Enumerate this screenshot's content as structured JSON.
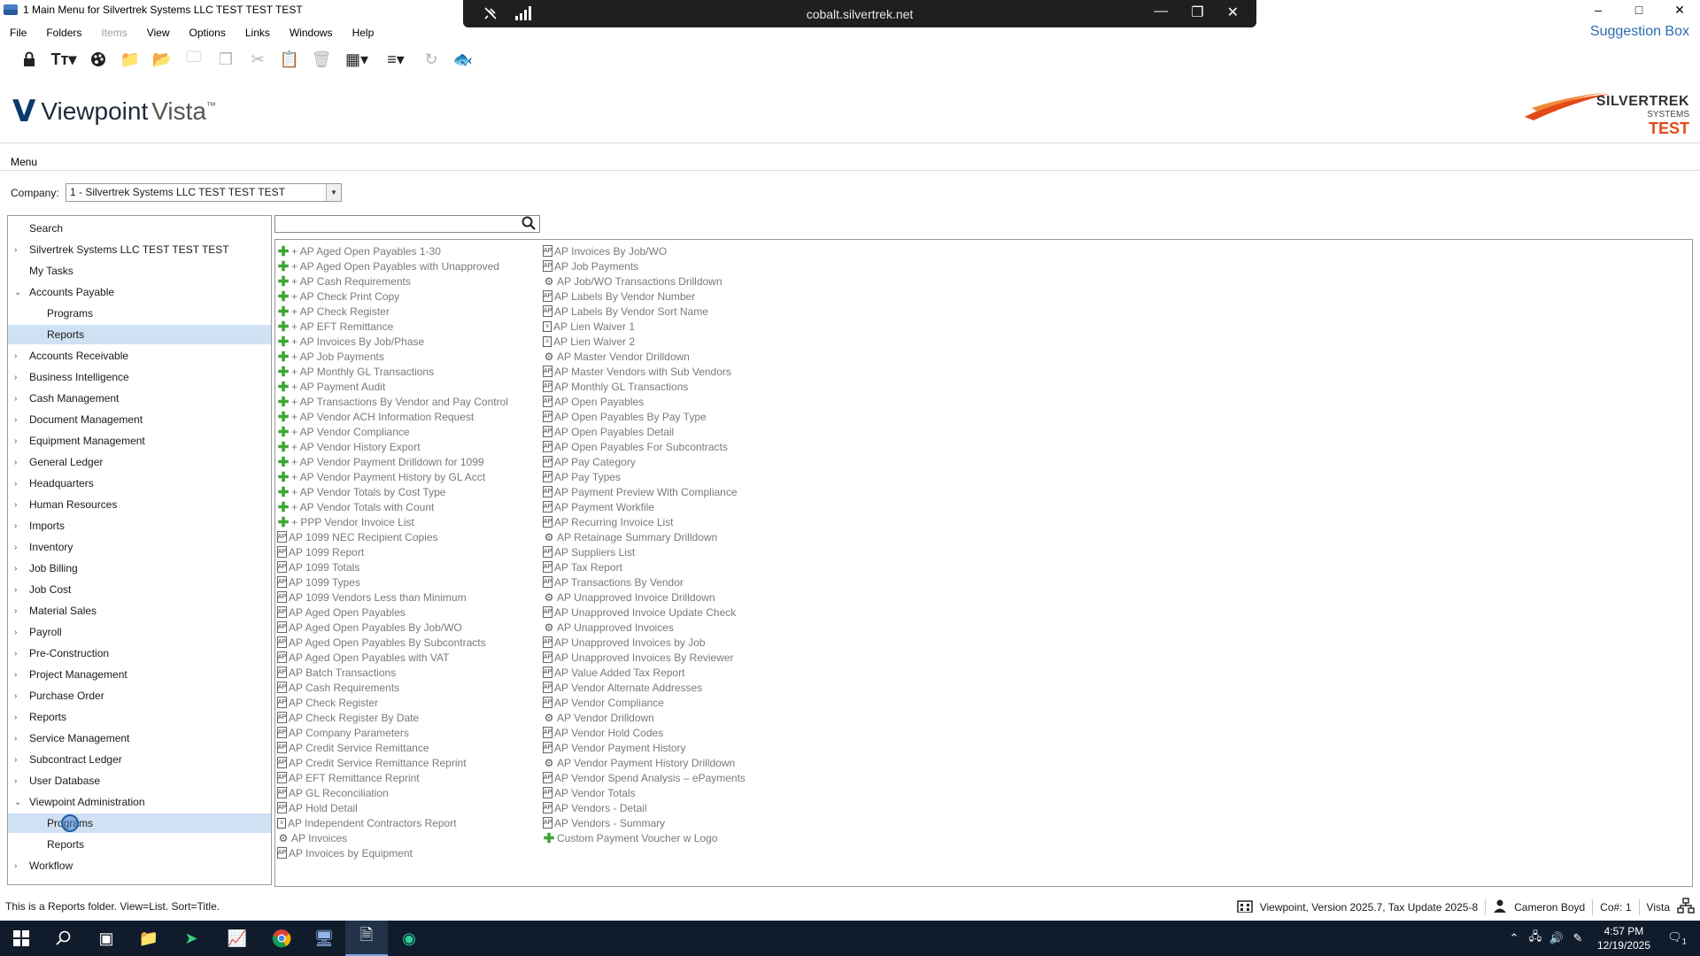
{
  "window": {
    "title": "1 Main Menu for Silvertrek Systems LLC TEST TEST TEST",
    "minimize": "–",
    "maximize": "□",
    "close": "✕"
  },
  "remote": {
    "host": "cobalt.silvertrek.net",
    "minimize": "—",
    "restore": "❐",
    "close": "✕"
  },
  "menubar": {
    "items": [
      "File",
      "Folders",
      "Items",
      "View",
      "Options",
      "Links",
      "Windows",
      "Help"
    ],
    "disabled_index": 2,
    "suggestion": "Suggestion Box"
  },
  "logos": {
    "viewpoint": "Viewpoint",
    "vista": "Vista",
    "tm": "™",
    "silvertrek_1": "SILVERTREK",
    "silvertrek_2": "SYSTEMS",
    "silvertrek_3": "TEST"
  },
  "tabs": {
    "menu": "Menu"
  },
  "company": {
    "label": "Company:",
    "value": "1 - Silvertrek Systems LLC TEST TEST TEST"
  },
  "nav": [
    {
      "label": "Search",
      "level": 0,
      "chev": ""
    },
    {
      "label": "Silvertrek Systems LLC TEST TEST TEST",
      "level": 0,
      "chev": "›"
    },
    {
      "label": "My Tasks",
      "level": 0,
      "chev": ""
    },
    {
      "label": "Accounts Payable",
      "level": 0,
      "chev": "⌄"
    },
    {
      "label": "Programs",
      "level": 1,
      "chev": ""
    },
    {
      "label": "Reports",
      "level": 1,
      "chev": ""
    },
    {
      "label": "Accounts Receivable",
      "level": 0,
      "chev": "›"
    },
    {
      "label": "Business Intelligence",
      "level": 0,
      "chev": "›"
    },
    {
      "label": "Cash Management",
      "level": 0,
      "chev": "›"
    },
    {
      "label": "Document Management",
      "level": 0,
      "chev": "›"
    },
    {
      "label": "Equipment Management",
      "level": 0,
      "chev": "›"
    },
    {
      "label": "General Ledger",
      "level": 0,
      "chev": "›"
    },
    {
      "label": "Headquarters",
      "level": 0,
      "chev": "›"
    },
    {
      "label": "Human Resources",
      "level": 0,
      "chev": "›"
    },
    {
      "label": "Imports",
      "level": 0,
      "chev": "›"
    },
    {
      "label": "Inventory",
      "level": 0,
      "chev": "›"
    },
    {
      "label": "Job Billing",
      "level": 0,
      "chev": "›"
    },
    {
      "label": "Job Cost",
      "level": 0,
      "chev": "›"
    },
    {
      "label": "Material Sales",
      "level": 0,
      "chev": "›"
    },
    {
      "label": "Payroll",
      "level": 0,
      "chev": "›"
    },
    {
      "label": "Pre-Construction",
      "level": 0,
      "chev": "›"
    },
    {
      "label": "Project Management",
      "level": 0,
      "chev": "›"
    },
    {
      "label": "Purchase Order",
      "level": 0,
      "chev": "›"
    },
    {
      "label": "Reports",
      "level": 0,
      "chev": "›"
    },
    {
      "label": "Service Management",
      "level": 0,
      "chev": "›"
    },
    {
      "label": "Subcontract Ledger",
      "level": 0,
      "chev": "›"
    },
    {
      "label": "User Database",
      "level": 0,
      "chev": "›"
    },
    {
      "label": "Viewpoint Administration",
      "level": 0,
      "chev": "⌄"
    },
    {
      "label": "Programs",
      "level": 1,
      "chev": ""
    },
    {
      "label": "Reports",
      "level": 1,
      "chev": ""
    },
    {
      "label": "Workflow",
      "level": 0,
      "chev": "›"
    }
  ],
  "nav_selected": [
    5,
    28
  ],
  "search": {
    "placeholder": ""
  },
  "reports_col1": [
    {
      "t": "+ AP Aged Open Payables 1-30",
      "i": "plus"
    },
    {
      "t": "+ AP Aged Open Payables with Unapproved",
      "i": "plus"
    },
    {
      "t": "+ AP Cash Requirements",
      "i": "plus"
    },
    {
      "t": "+ AP Check Print Copy",
      "i": "plus"
    },
    {
      "t": "+ AP Check Register",
      "i": "plus"
    },
    {
      "t": "+ AP EFT Remittance",
      "i": "plus"
    },
    {
      "t": "+ AP Invoices By Job/Phase",
      "i": "plus"
    },
    {
      "t": "+ AP Job Payments",
      "i": "plus"
    },
    {
      "t": "+ AP Monthly GL Transactions",
      "i": "plus"
    },
    {
      "t": "+ AP Payment Audit",
      "i": "plus"
    },
    {
      "t": "+ AP Transactions By Vendor and Pay Control",
      "i": "plus"
    },
    {
      "t": "+ AP Vendor ACH Information Request",
      "i": "plus"
    },
    {
      "t": "+ AP Vendor Compliance",
      "i": "plus"
    },
    {
      "t": "+ AP Vendor History Export",
      "i": "plus"
    },
    {
      "t": "+ AP Vendor Payment Drilldown for 1099",
      "i": "plus"
    },
    {
      "t": "+ AP Vendor Payment History by GL Acct",
      "i": "plus"
    },
    {
      "t": "+ AP Vendor Totals by Cost Type",
      "i": "plus"
    },
    {
      "t": "+ AP Vendor Totals with Count",
      "i": "plus"
    },
    {
      "t": "+ PPP Vendor Invoice List",
      "i": "plus"
    },
    {
      "t": "AP 1099 NEC Recipient Copies",
      "i": "rep"
    },
    {
      "t": "AP 1099 Report",
      "i": "rep"
    },
    {
      "t": "AP 1099 Totals",
      "i": "rep"
    },
    {
      "t": "AP 1099 Types",
      "i": "rep"
    },
    {
      "t": "AP 1099 Vendors Less than Minimum",
      "i": "rep"
    },
    {
      "t": "AP Aged Open Payables",
      "i": "rep"
    },
    {
      "t": "AP Aged Open Payables By Job/WO",
      "i": "rep"
    },
    {
      "t": "AP Aged Open Payables By Subcontracts",
      "i": "rep"
    },
    {
      "t": "AP Aged Open Payables with VAT",
      "i": "rep"
    },
    {
      "t": "AP Batch Transactions",
      "i": "rep"
    },
    {
      "t": "AP Cash Requirements",
      "i": "rep"
    },
    {
      "t": "AP Check Register",
      "i": "rep"
    },
    {
      "t": "AP Check Register By Date",
      "i": "rep"
    },
    {
      "t": "AP Company Parameters",
      "i": "rep"
    },
    {
      "t": "AP Credit Service Remittance",
      "i": "rep"
    },
    {
      "t": "AP Credit Service Remittance Reprint",
      "i": "rep"
    },
    {
      "t": "AP EFT Remittance Reprint",
      "i": "rep"
    },
    {
      "t": "AP GL Reconciliation",
      "i": "rep"
    },
    {
      "t": "AP Hold Detail",
      "i": "rep"
    },
    {
      "t": "AP Independent Contractors Report",
      "i": "doc"
    },
    {
      "t": "AP Invoices",
      "i": "gear"
    },
    {
      "t": "AP Invoices by Equipment",
      "i": "rep"
    }
  ],
  "reports_col2": [
    {
      "t": "AP Invoices By Job/WO",
      "i": "rep"
    },
    {
      "t": "AP Job Payments",
      "i": "rep"
    },
    {
      "t": "AP Job/WO Transactions Drilldown",
      "i": "gear"
    },
    {
      "t": "AP Labels By Vendor Number",
      "i": "rep"
    },
    {
      "t": "AP Labels By Vendor Sort Name",
      "i": "rep"
    },
    {
      "t": "AP Lien Waiver 1",
      "i": "doc"
    },
    {
      "t": "AP Lien Waiver 2",
      "i": "doc"
    },
    {
      "t": "AP Master Vendor Drilldown",
      "i": "gear"
    },
    {
      "t": "AP Master Vendors with Sub Vendors",
      "i": "rep"
    },
    {
      "t": "AP Monthly GL Transactions",
      "i": "rep"
    },
    {
      "t": "AP Open Payables",
      "i": "rep"
    },
    {
      "t": "AP Open Payables By Pay Type",
      "i": "rep"
    },
    {
      "t": "AP Open Payables Detail",
      "i": "rep"
    },
    {
      "t": "AP Open Payables For Subcontracts",
      "i": "rep"
    },
    {
      "t": "AP Pay Category",
      "i": "rep"
    },
    {
      "t": "AP Pay Types",
      "i": "rep"
    },
    {
      "t": "AP Payment Preview With Compliance",
      "i": "rep"
    },
    {
      "t": "AP Payment Workfile",
      "i": "rep"
    },
    {
      "t": "AP Recurring Invoice List",
      "i": "rep"
    },
    {
      "t": "AP Retainage Summary Drilldown",
      "i": "gear"
    },
    {
      "t": "AP Suppliers List",
      "i": "rep"
    },
    {
      "t": "AP Tax Report",
      "i": "rep"
    },
    {
      "t": "AP Transactions By Vendor",
      "i": "rep"
    },
    {
      "t": "AP Unapproved Invoice Drilldown",
      "i": "gear"
    },
    {
      "t": "AP Unapproved Invoice Update Check",
      "i": "rep"
    },
    {
      "t": "AP Unapproved Invoices",
      "i": "gear"
    },
    {
      "t": "AP Unapproved Invoices by Job",
      "i": "rep"
    },
    {
      "t": "AP Unapproved Invoices By Reviewer",
      "i": "rep"
    },
    {
      "t": "AP Value Added Tax Report",
      "i": "rep"
    },
    {
      "t": "AP Vendor Alternate Addresses",
      "i": "rep"
    },
    {
      "t": "AP Vendor Compliance",
      "i": "rep"
    },
    {
      "t": "AP Vendor Drilldown",
      "i": "gear"
    },
    {
      "t": "AP Vendor Hold Codes",
      "i": "rep"
    },
    {
      "t": "AP Vendor Payment History",
      "i": "rep"
    },
    {
      "t": "AP Vendor Payment History Drilldown",
      "i": "gear"
    },
    {
      "t": "AP Vendor Spend Analysis – ePayments",
      "i": "rep"
    },
    {
      "t": "AP Vendor Totals",
      "i": "rep"
    },
    {
      "t": "AP Vendors - Detail",
      "i": "rep"
    },
    {
      "t": "AP Vendors - Summary",
      "i": "rep"
    },
    {
      "t": "Custom Payment Voucher w Logo",
      "i": "plus"
    }
  ],
  "status": {
    "left": "This is a Reports folder. View=List. Sort=Title.",
    "version": "Viewpoint, Version 2025.7, Tax Update 2025-8",
    "user": "Cameron Boyd",
    "company": "Co#: 1",
    "env": "Vista"
  },
  "taskbar": {
    "time": "4:57 PM",
    "date": "12/19/2025",
    "notif_count": "1"
  },
  "colors": {
    "accent": "#2b6cb0",
    "selection": "#cfe1f3",
    "taskbar": "#101c2b",
    "plus_icon": "#3fa535"
  }
}
